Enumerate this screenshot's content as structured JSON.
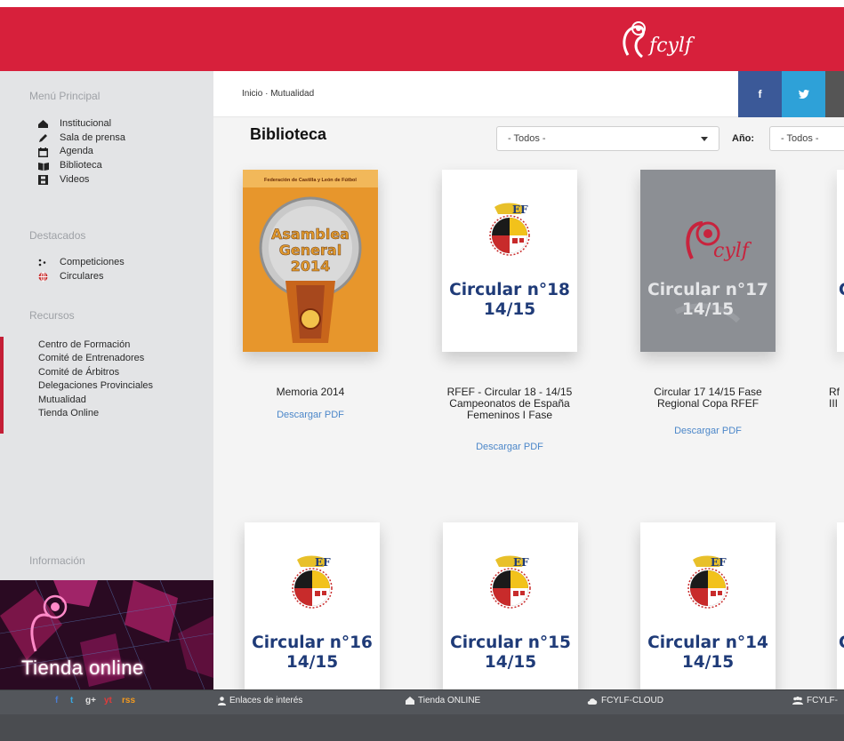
{
  "colors": {
    "brand_red": "#d7203b",
    "sidebar_bg": "#e3e4e6",
    "link_blue": "#4c87c9",
    "facebook": "#3b5998",
    "twitter": "#2ea1d8"
  },
  "header": {
    "logo_text": "fcylf"
  },
  "sidebar": {
    "menu_title": "Menú Principal",
    "menu": [
      {
        "label": "Institucional",
        "icon": "institution-icon"
      },
      {
        "label": "Sala de prensa",
        "icon": "pen-icon"
      },
      {
        "label": "Agenda",
        "icon": "calendar-icon"
      },
      {
        "label": "Biblioteca",
        "icon": "book-icon"
      },
      {
        "label": "Videos",
        "icon": "film-icon"
      }
    ],
    "featured_title": "Destacados",
    "featured": [
      {
        "label": "Competiciones",
        "icon": "competition-icon"
      },
      {
        "label": "Circulares",
        "icon": "globe-icon"
      }
    ],
    "resources_title": "Recursos",
    "resources": [
      "Centro de Formación",
      "Comité de Entrenadores",
      "Comité de Árbitros",
      "Delegaciones Provinciales",
      "Mutualidad",
      "Tienda Online"
    ],
    "info_title": "Información",
    "banner_text": "Tienda online"
  },
  "main": {
    "breadcrumb": "Inicio · Mutualidad",
    "social": {
      "facebook": "f",
      "twitter": "t"
    },
    "page_title": "Biblioteca",
    "filter_category": "- Todos -",
    "year_label": "Año:",
    "filter_year": "- Todos -",
    "download_label": "Descargar PDF",
    "cards": [
      {
        "cover": "Asamblea General 2014",
        "cover_header": "Federación de Castilla y León de Fútbol",
        "title": [
          "Memoria 2014"
        ]
      },
      {
        "cover": [
          "Circular n°18",
          "14/15"
        ],
        "title": [
          "RFEF - Circular 18 - 14/15",
          "Campeonatos de España",
          "Femeninos I Fase"
        ]
      },
      {
        "cover": [
          "Circular n°17",
          "14/15"
        ],
        "title": [
          "Circular 17 14/15 Fase",
          "Regional Copa RFEF"
        ]
      },
      {
        "partial_title": [
          "Rf",
          "III"
        ],
        "partial_cover_letter": "C"
      },
      {
        "cover": [
          "Circular n°16",
          "14/15"
        ]
      },
      {
        "cover": [
          "Circular n°15",
          "14/15"
        ]
      },
      {
        "cover": [
          "Circular n°14",
          "14/15"
        ]
      },
      {
        "partial_cover_letter": "C"
      }
    ]
  },
  "footer": {
    "social": [
      "f",
      "t",
      "g+",
      "yt",
      "rss"
    ],
    "links": [
      {
        "label": "Enlaces de interés",
        "icon": "person-icon"
      },
      {
        "label": "Tienda ONLINE",
        "icon": "home-icon"
      },
      {
        "label": "FCYLF-CLOUD",
        "icon": "cloud-icon"
      },
      {
        "label": "FCYLF-",
        "icon": "group-icon"
      }
    ]
  }
}
